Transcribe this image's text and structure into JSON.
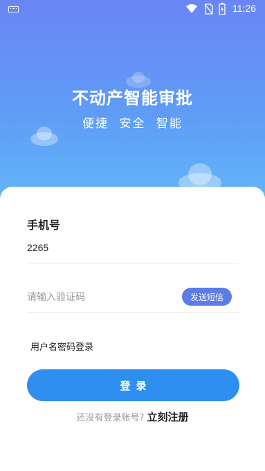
{
  "status_bar": {
    "time": "11:26",
    "icons": [
      "keyboard-icon",
      "wifi-icon",
      "no-sim-icon",
      "battery-icon"
    ]
  },
  "hero": {
    "title": "不动产智能审批",
    "subtitle": "便捷  安全  智能"
  },
  "form": {
    "phone_label": "手机号",
    "phone_value": "2265",
    "code_placeholder": "请输入验证码",
    "send_sms_label": "发送短信",
    "password_login_label": "用户名密码登录",
    "login_label": "登录"
  },
  "register": {
    "prompt": "还没有登录账号?",
    "link": "立刻注册"
  },
  "colors": {
    "hero_top": "#6a86f5",
    "hero_bottom": "#62b8f8",
    "send_sms_bg": "#5c7ce6",
    "login_bg": "#2f8ff1"
  }
}
